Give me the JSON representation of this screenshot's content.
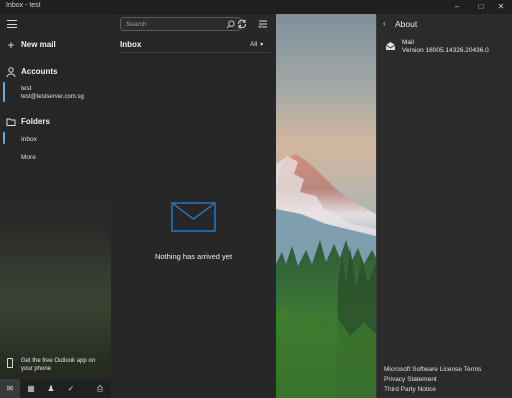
{
  "window": {
    "title": "Inbox - test",
    "controls": [
      "minimize-icon",
      "maximize-icon",
      "close-icon"
    ]
  },
  "nav": {
    "menu_icon": "hamburger-icon",
    "new_mail": {
      "label": "New mail",
      "icon": "plus-icon"
    },
    "accounts": {
      "label": "Accounts",
      "icon": "person-icon",
      "account_name": "test",
      "account_email": "test@testserver.com.sg"
    },
    "folders": {
      "label": "Folders",
      "icon": "folder-icon",
      "items": [
        "Inbox"
      ],
      "more": "More"
    },
    "promo": {
      "text": "Get the free Outlook app on your phone",
      "icon": "phone-icon"
    },
    "bottom_bar": [
      "mail-icon",
      "calendar-icon",
      "people-icon",
      "todo-icon",
      "printer-icon"
    ]
  },
  "list": {
    "search_placeholder": "Search",
    "sync_icon": "sync-icon",
    "filter_icon": "filter-icon",
    "folder_title": "Inbox",
    "filter_label": "All",
    "empty_message": "Nothing has arrived yet",
    "empty_icon": "envelope-icon"
  },
  "about": {
    "title": "About",
    "app_name": "Mail",
    "version": "Version 16005.14326.20436.0",
    "links": [
      "Microsoft Software License Terms",
      "Privacy Statement",
      "Third Party Notice"
    ]
  },
  "colors": {
    "accent": "#6ea8d8",
    "envelope": "#2f6fb0"
  }
}
